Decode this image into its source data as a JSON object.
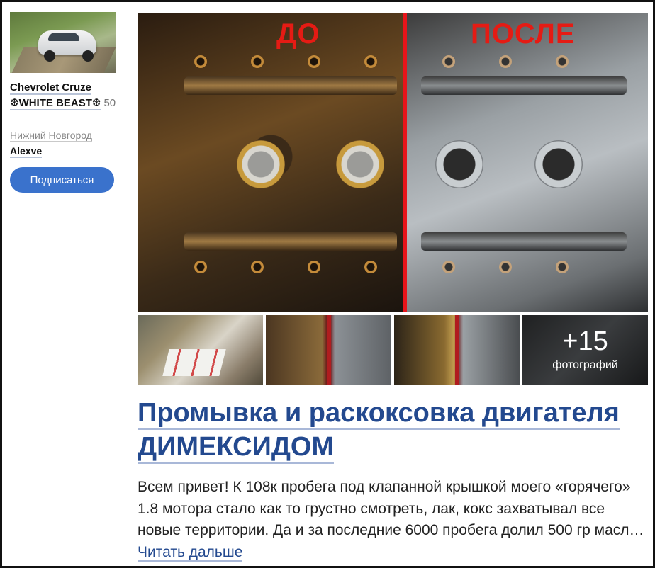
{
  "sidebar": {
    "car_name": "Chevrolet Cruze ❆WHITE BEAST❆",
    "car_count": "50",
    "city": "Нижний Новгород",
    "author": "Alexve",
    "subscribe_label": "Подписаться"
  },
  "gallery": {
    "main_labels": {
      "before": "ДО",
      "after": "ПОСЛЕ"
    },
    "more_count": "+15",
    "more_label": "фотографий"
  },
  "post": {
    "title": "Промывка и раскоксовка двигателя ДИМЕКСИДОМ",
    "excerpt": "Всем привет! К 108к пробега под клапанной крышкой моего «горячего» 1.8 мотора стало как то грустно смотреть, лак, кокс захватывал все новые территории. Да и за последние 6000 пробега долил 500 гр масл…",
    "read_more": "Читать дальше"
  },
  "colors": {
    "accent": "#3a72cc",
    "title": "#23498f",
    "label_red": "#e51b14"
  }
}
